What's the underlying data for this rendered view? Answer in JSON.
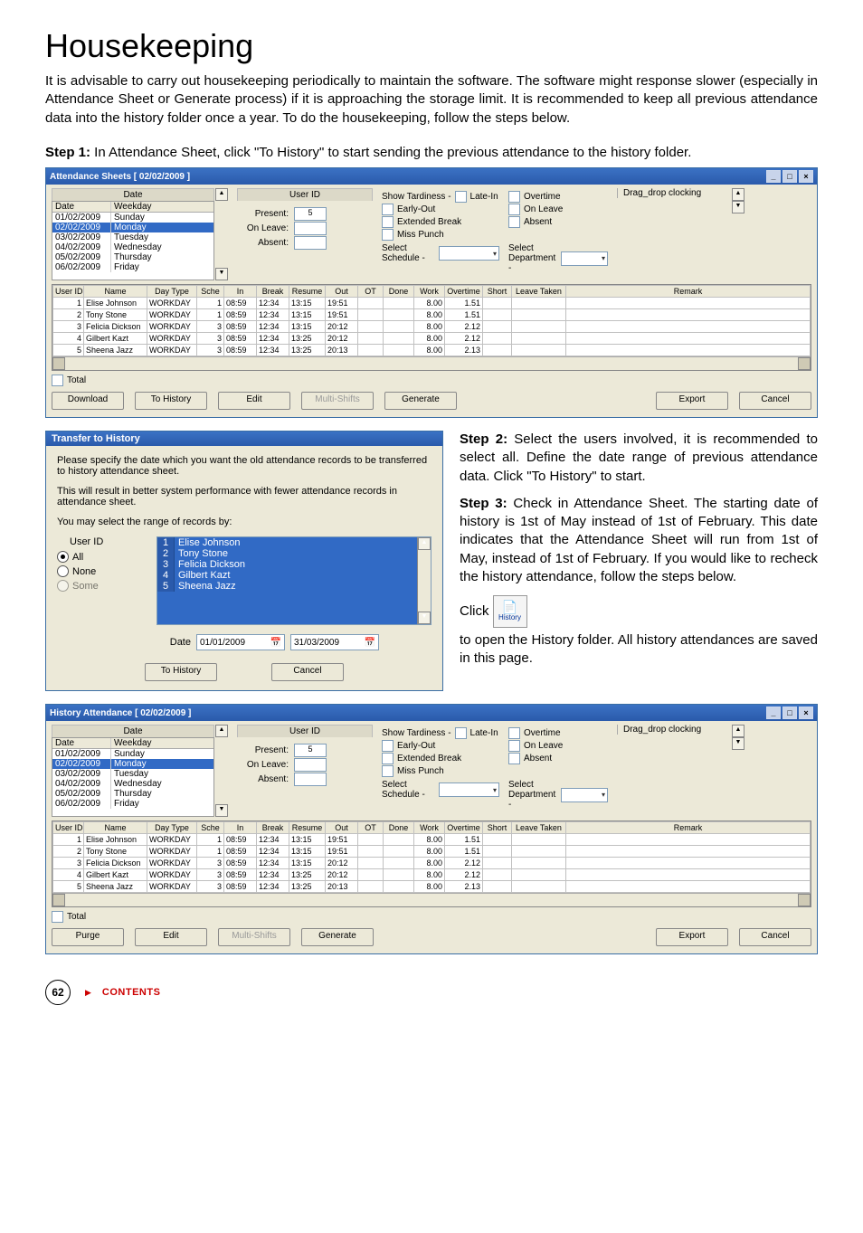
{
  "heading": "Housekeeping",
  "intro_text": "It is advisable to carry out housekeeping periodically to maintain the software. The software might response slower (especially in Attendance Sheet or Generate process) if it is approaching the storage limit. It is recommended to keep all previous attendance data into the history folder once a year. To do the housekeeping, follow the steps below.",
  "step1_label": "Step 1:",
  "step1_text": " In Attendance Sheet, click \"To History\" to start sending the previous attendance to the history folder.",
  "step2_label": "Step 2:",
  "step2_text": " Select the users involved, it is recommended to select all. Define the date range of previous attendance data. Click \"To History\" to start.",
  "step3_label": "Step 3:",
  "step3_text": " Check in Attendance Sheet. The starting date of history is 1st of May instead of 1st of February. This date indicates that the Attendance Sheet will run from 1st of May, instead of 1st of February. If you would like to recheck the history attendance, follow the steps below.",
  "click_prefix": "Click",
  "click_suffix": " to open the History folder. All history attendances are saved in this page.",
  "history_btn_label": "History",
  "attendance_win": {
    "title": "Attendance Sheets   [ 02/02/2009 ]",
    "date_head": "Date",
    "date_cols": [
      "Date",
      "Weekday"
    ],
    "date_rows": [
      {
        "d": "01/02/2009",
        "w": "Sunday",
        "sel": false
      },
      {
        "d": "02/02/2009",
        "w": "Monday",
        "sel": true
      },
      {
        "d": "03/02/2009",
        "w": "Tuesday",
        "sel": false
      },
      {
        "d": "04/02/2009",
        "w": "Wednesday",
        "sel": false
      },
      {
        "d": "05/02/2009",
        "w": "Thursday",
        "sel": false
      },
      {
        "d": "06/02/2009",
        "w": "Friday",
        "sel": false
      }
    ],
    "userid_head": "User ID",
    "present_lbl": "Present:",
    "present_val": "5",
    "onleave_lbl": "On Leave:",
    "absent_lbl": "Absent:",
    "show_tardiness": "Show Tardiness -",
    "cb_latein": "Late-In",
    "cb_earlyout": "Early-Out",
    "cb_extbreak": "Extended Break",
    "cb_misspunch": "Miss Punch",
    "cb_overtime": "Overtime",
    "cb_onleave": "On Leave",
    "cb_absent": "Absent",
    "sel_sched": "Select Schedule -",
    "sel_dept": "Select Department -",
    "drag_label": "Drag_drop clocking",
    "grid_headers": [
      "User ID",
      "Name",
      "Day Type",
      "Sche",
      "In",
      "Break",
      "Resume",
      "Out",
      "OT",
      "Done",
      "Work",
      "Overtime",
      "Short",
      "Leave Taken",
      "Remark"
    ],
    "grid_rows": [
      [
        "1",
        "Elise Johnson",
        "WORKDAY",
        "1",
        "08:59",
        "12:34",
        "13:15",
        "19:51",
        "",
        "",
        "8.00",
        "1.51",
        "",
        "",
        ""
      ],
      [
        "2",
        "Tony Stone",
        "WORKDAY",
        "1",
        "08:59",
        "12:34",
        "13:15",
        "19:51",
        "",
        "",
        "8.00",
        "1.51",
        "",
        "",
        ""
      ],
      [
        "3",
        "Felicia Dickson",
        "WORKDAY",
        "3",
        "08:59",
        "12:34",
        "13:15",
        "20:12",
        "",
        "",
        "8.00",
        "2.12",
        "",
        "",
        ""
      ],
      [
        "4",
        "Gilbert Kazt",
        "WORKDAY",
        "3",
        "08:59",
        "12:34",
        "13:25",
        "20:12",
        "",
        "",
        "8.00",
        "2.12",
        "",
        "",
        ""
      ],
      [
        "5",
        "Sheena Jazz",
        "WORKDAY",
        "3",
        "08:59",
        "12:34",
        "13:25",
        "20:13",
        "",
        "",
        "8.00",
        "2.13",
        "",
        "",
        ""
      ]
    ],
    "total_lbl": "Total",
    "footer_buttons": {
      "download": "Download",
      "tohistory": "To History",
      "edit": "Edit",
      "multishifts": "Multi-Shifts",
      "generate": "Generate",
      "export": "Export",
      "cancel": "Cancel"
    }
  },
  "transfer_dlg": {
    "title": "Transfer to History",
    "msg1": "Please specify the date which you want the old attendance records to be transferred to history attendance sheet.",
    "msg2": "This will result in better system performance with fewer attendance records in attendance sheet.",
    "range_label": "You may select the range of records by:",
    "userid_head": "User ID",
    "radios": {
      "all": "All",
      "none": "None",
      "some": "Some"
    },
    "users": [
      {
        "n": "1",
        "t": "Elise Johnson"
      },
      {
        "n": "2",
        "t": "Tony Stone"
      },
      {
        "n": "3",
        "t": "Felicia Dickson"
      },
      {
        "n": "4",
        "t": "Gilbert Kazt"
      },
      {
        "n": "5",
        "t": "Sheena Jazz"
      }
    ],
    "date_lbl": "Date",
    "date_from": "01/01/2009",
    "date_to": "31/03/2009",
    "btn_tohistory": "To History",
    "btn_cancel": "Cancel"
  },
  "history_win": {
    "title": "History Attendance   [ 02/02/2009 ]",
    "footer_buttons": {
      "purge": "Purge",
      "edit": "Edit",
      "multishifts": "Multi-Shifts",
      "generate": "Generate",
      "export": "Export",
      "cancel": "Cancel"
    }
  },
  "page_number": "62",
  "contents_label": "CONTENTS"
}
